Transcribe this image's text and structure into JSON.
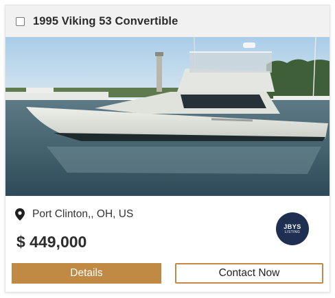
{
  "listing": {
    "title": "1995 Viking 53 Convertible",
    "location": "Port Clinton,, OH, US",
    "price": "$ 449,000",
    "checked": false
  },
  "broker_badge": {
    "main": "JBYS",
    "sub": "LISTING"
  },
  "buttons": {
    "details": "Details",
    "contact": "Contact Now"
  },
  "icons": {
    "location": "map-pin-icon"
  },
  "colors": {
    "accent": "#c08a45",
    "badge": "#1f2f52",
    "header_bg": "#f1f1f1"
  }
}
